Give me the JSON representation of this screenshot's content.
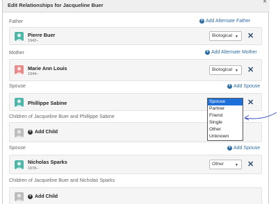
{
  "dialog": {
    "title": "Edit Relationships for Jacqueline Buer",
    "close_glyph": "×"
  },
  "father": {
    "label": "Father",
    "add_link": "Add Alternate Father",
    "name": "Pierre Buer",
    "dates": "1942–",
    "relationship": "Biological"
  },
  "mother": {
    "label": "Mother",
    "add_link": "Add Alternate Mother",
    "name": "Marie Ann Louis",
    "dates": "1944–",
    "relationship": "Biological"
  },
  "spouse1": {
    "label": "Spouse",
    "add_link": "Add Spouse",
    "name": "Phillippe Sabine",
    "relationship": "Spouse",
    "options": [
      "Spouse",
      "Partner",
      "Friend",
      "Single",
      "Other",
      "Unknown"
    ]
  },
  "children1": {
    "label": "Children of Jacqueline Buer and Phillippe Sabine",
    "add_child": "Add Child"
  },
  "spouse2": {
    "label": "Spouse",
    "add_link": "Add Spouse",
    "name": "Nicholas Sparks",
    "dates": "1978–",
    "relationship": "Other"
  },
  "children2": {
    "label": "Children of Jacqueline Buer and Nicholas Sparks",
    "add_child": "Add Child"
  },
  "colors": {
    "link": "#2e6da4",
    "male_avatar": "#4fb5a8",
    "female_avatar": "#e88a8a",
    "selected_option": "#1e6fd9",
    "annotation_arrow": "#3a4fc0"
  },
  "icons": [
    "close-icon",
    "plus-circle-icon",
    "person-icon",
    "remove-icon",
    "caret-down-icon"
  ]
}
